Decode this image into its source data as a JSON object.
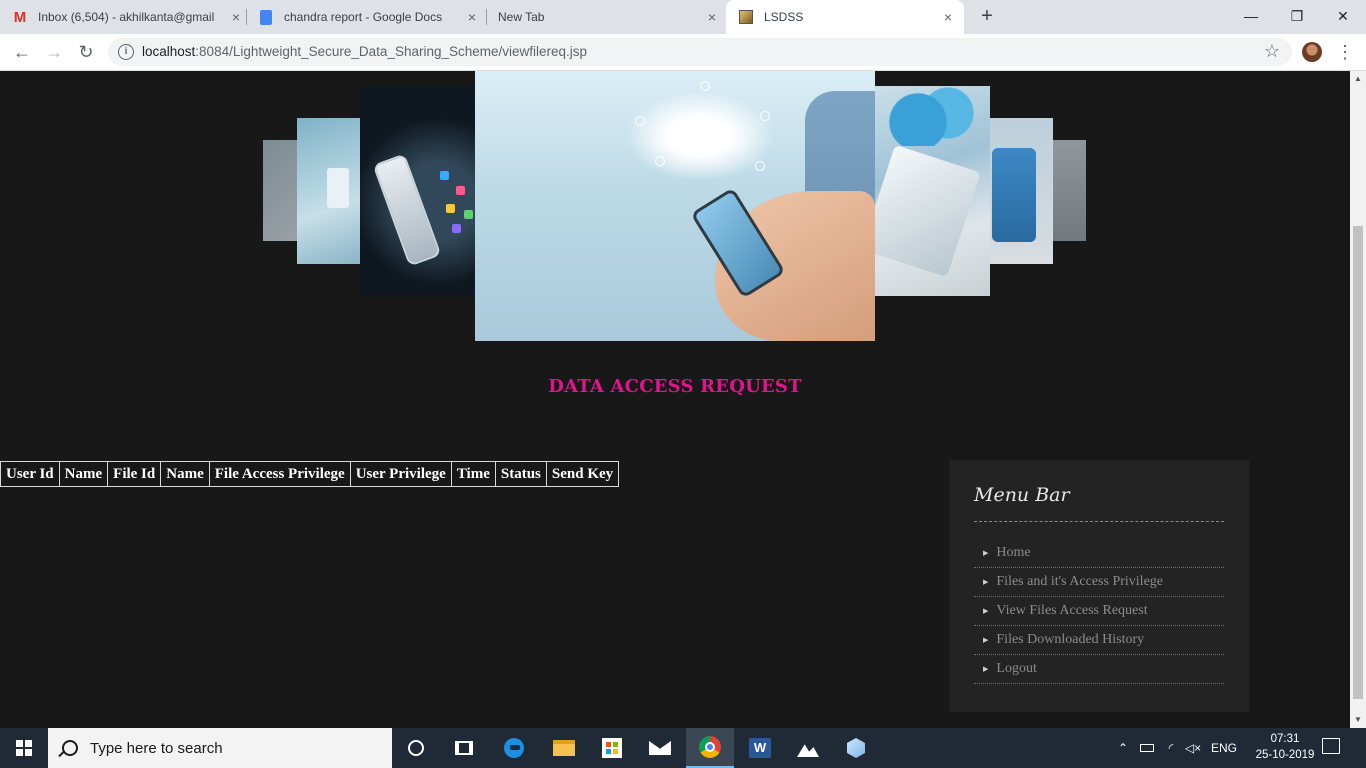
{
  "browser": {
    "tabs": [
      {
        "title": "Inbox (6,504) - akhilkanta@gmail",
        "icon": "gmail-icon"
      },
      {
        "title": "chandra report - Google Docs",
        "icon": "docs-icon"
      },
      {
        "title": "New Tab",
        "icon": ""
      },
      {
        "title": "LSDSS",
        "icon": "site-favicon"
      }
    ],
    "url_host": "localhost",
    "url_path": ":8084/Lightweight_Secure_Data_Sharing_Scheme/viewfilereq.jsp",
    "new_tab_symbol": "+",
    "minimize_symbol": "—",
    "restore_symbol": "❐",
    "close_symbol": "✕"
  },
  "page": {
    "title": "DATA ACCESS REQUEST",
    "title_color": "#e0148c",
    "table": {
      "headers": [
        "User Id",
        "Name",
        "File Id",
        "Name",
        "File Access Privilege",
        "User Privilege",
        "Time",
        "Status",
        "Send Key"
      ],
      "rows": []
    },
    "menu": {
      "title": "Menu Bar",
      "items": [
        {
          "label": "Home"
        },
        {
          "label": "Files and it's Access Privilege"
        },
        {
          "label": "View Files Access Request"
        },
        {
          "label": "Files Downloaded History"
        },
        {
          "label": "Logout"
        }
      ]
    }
  },
  "taskbar": {
    "search_placeholder": "Type here to search",
    "language": "ENG",
    "time": "07:31",
    "date": "25-10-2019",
    "apps": [
      "task-view",
      "edge",
      "file-explorer",
      "store",
      "mail",
      "chrome",
      "word",
      "photos",
      "app-3d"
    ]
  }
}
